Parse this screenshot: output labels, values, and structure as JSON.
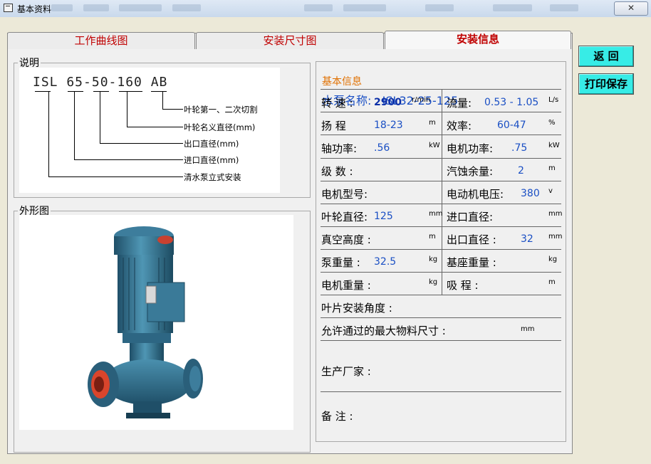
{
  "window": {
    "title": "基本资料",
    "close_label": "✕"
  },
  "tabs": [
    {
      "label": "工作曲线图",
      "active": false
    },
    {
      "label": "安装尺寸图",
      "active": false
    },
    {
      "label": "安装信息",
      "active": true
    }
  ],
  "buttons": {
    "back": "返  回",
    "print": "打印保存"
  },
  "explain": {
    "group_label": "说明",
    "model": "ISL 65-50-160 AB",
    "legend": [
      "叶轮第一、二次切割",
      "叶轮名义直径(mm)",
      "出口直径(mm)",
      "进口直径(mm)",
      "清水泵立式安装"
    ]
  },
  "outline": {
    "group_label": "外形图"
  },
  "info": {
    "group_label": "基本信息",
    "pump_name_label": "水泵名称:",
    "pump_name_value": "ISL32-25-125",
    "rows": [
      {
        "l_label": "转 速 :",
        "l_value": "2900",
        "l_unit": "r/min",
        "r_label": "流量:",
        "r_value": "0.53 - 1.05",
        "r_unit": "L/s"
      },
      {
        "l_label": "扬 程",
        "l_value": "18-23",
        "l_unit": "m",
        "r_label": "效率:",
        "r_value": "60-47",
        "r_unit": "%"
      },
      {
        "l_label": "轴功率:",
        "l_value": ".56",
        "l_unit": "kW",
        "r_label": "电机功率:",
        "r_value": ".75",
        "r_unit": "kW"
      },
      {
        "l_label": "级 数 :",
        "l_value": "",
        "l_unit": "",
        "r_label": "汽蚀余量:",
        "r_value": "2",
        "r_unit": "m"
      },
      {
        "l_label": "电机型号:",
        "l_value": "",
        "l_unit": "",
        "r_label": "电动机电压:",
        "r_value": "380",
        "r_unit": "v"
      },
      {
        "l_label": "叶轮直径:",
        "l_value": "125",
        "l_unit": "mm",
        "r_label": "进口直径:",
        "r_value": "",
        "r_unit": "mm"
      },
      {
        "l_label": "真空高度 :",
        "l_value": "",
        "l_unit": "m",
        "r_label": "出口直径 :",
        "r_value": "32",
        "r_unit": "mm"
      },
      {
        "l_label": "泵重量 :",
        "l_value": "32.5",
        "l_unit": "kg",
        "r_label": "基座重量 :",
        "r_value": "",
        "r_unit": "kg"
      },
      {
        "l_label": "电机重量 :",
        "l_value": "",
        "l_unit": "kg",
        "r_label": "吸 程 :",
        "r_value": "",
        "r_unit": "m"
      }
    ],
    "blade_angle_label": "叶片安装角度 :",
    "max_particle_label": "允许通过的最大物料尺寸 :",
    "max_particle_unit": "mm",
    "manufacturer_label": "生产厂家 :",
    "remark_label": "备  注 :"
  },
  "colors": {
    "label_red": "#c00000",
    "value_blue": "#1a4fc4",
    "header_orange": "#e07000",
    "button_cyan": "#37ece6",
    "pump_body": "#2f6f8e",
    "pump_flange_red": "#d9452c"
  }
}
